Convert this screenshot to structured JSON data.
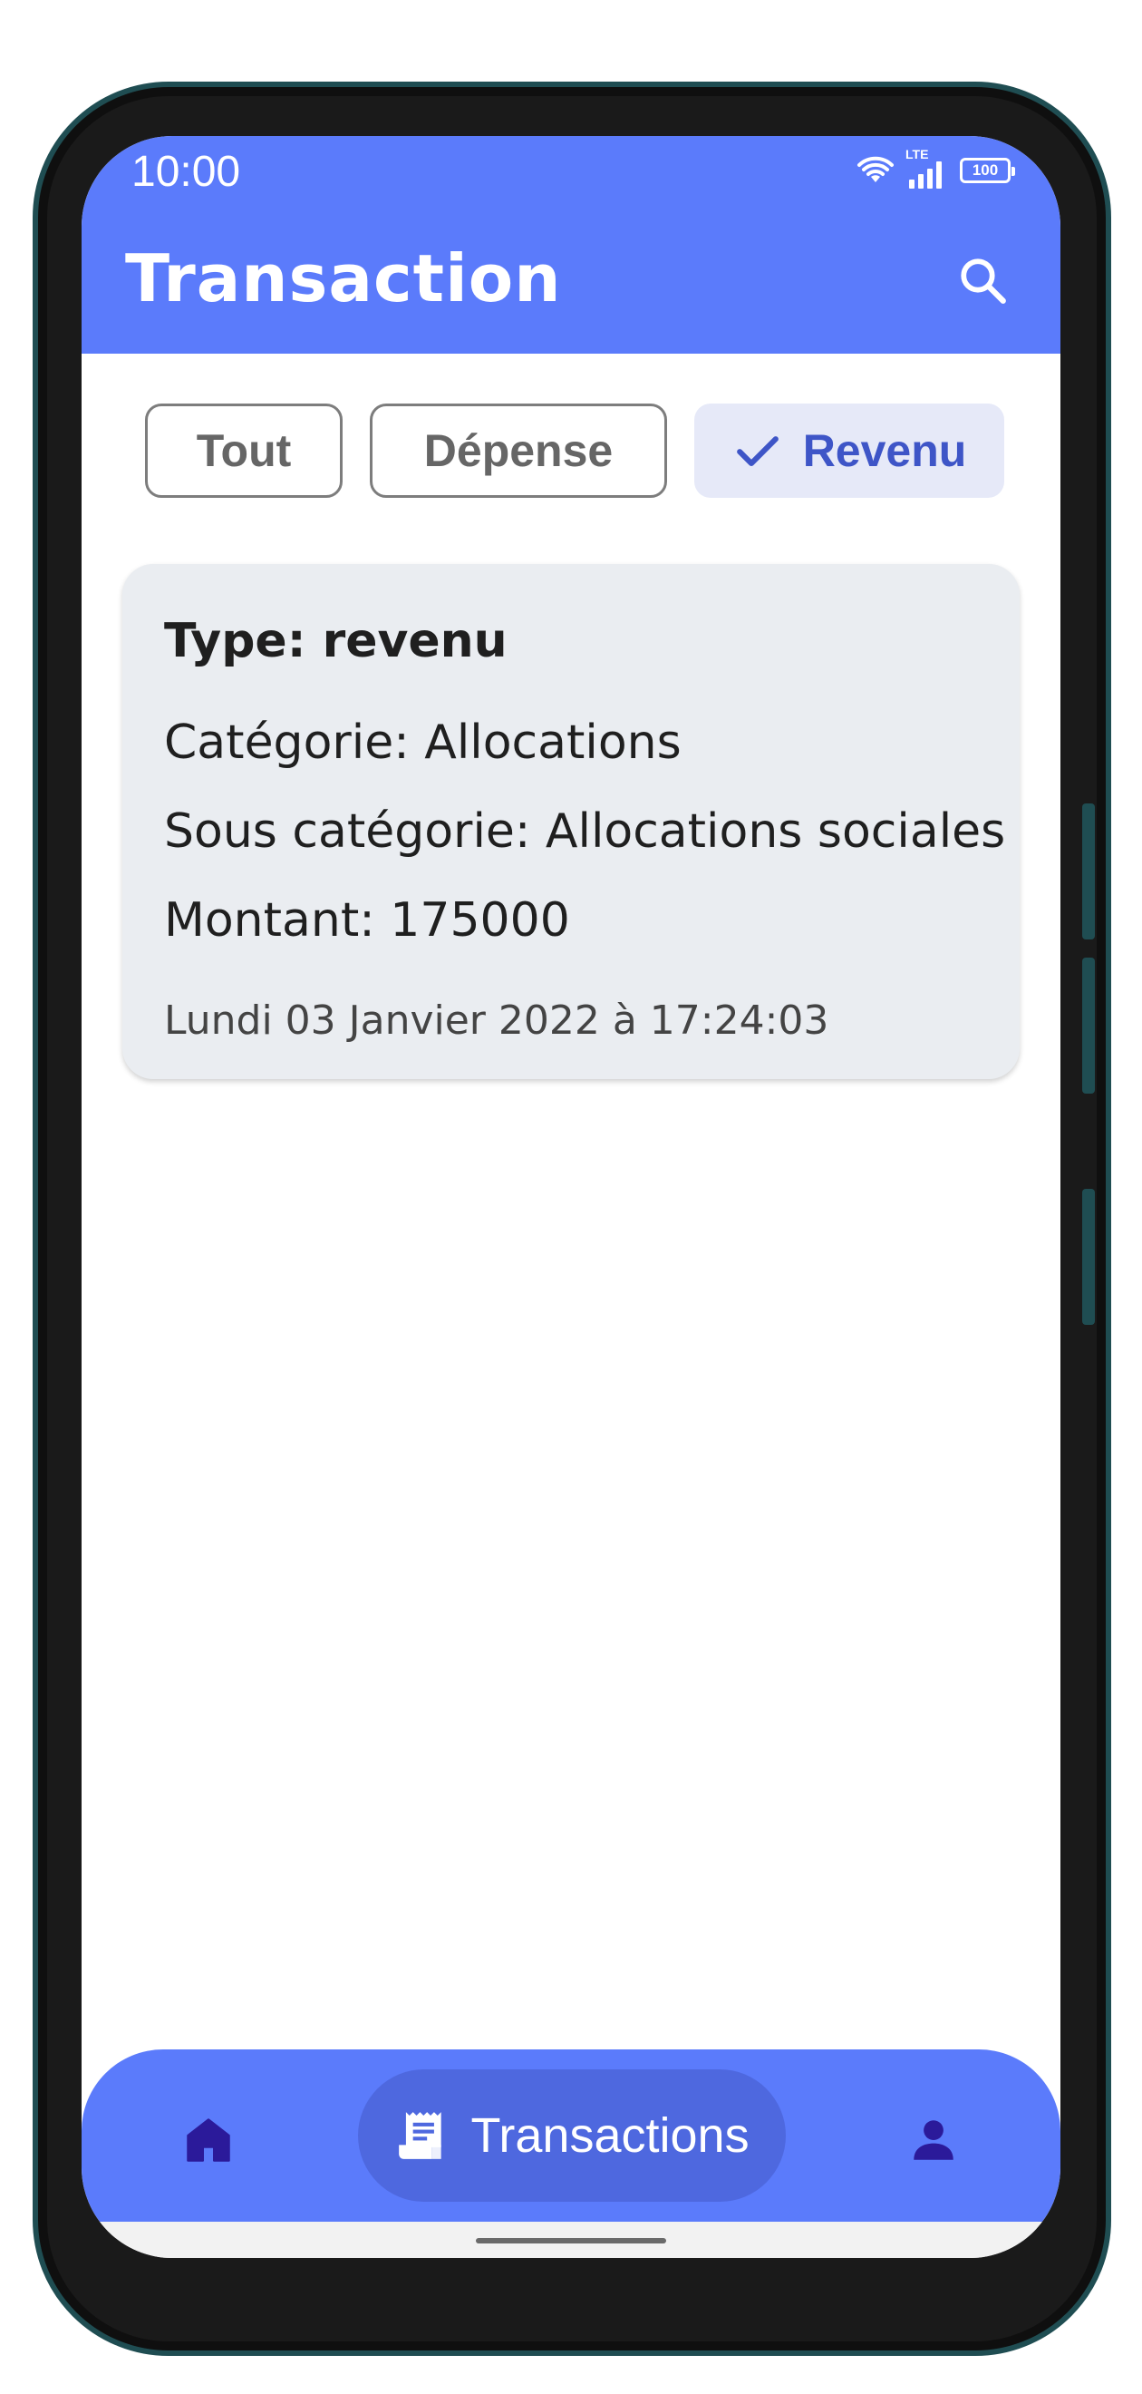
{
  "status_bar": {
    "time": "10:00",
    "network_label": "LTE",
    "battery_level": "100"
  },
  "app_bar": {
    "title": "Transaction",
    "search_icon": "search-icon"
  },
  "filters": {
    "selected": "Revenu",
    "chips": [
      {
        "label": "Tout"
      },
      {
        "label": "Dépense"
      },
      {
        "label": "Revenu"
      }
    ]
  },
  "transaction_card": {
    "type_line": "Type: revenu",
    "category_line": "Catégorie: Allocations",
    "subcategory_line": "Sous catégorie: Allocations sociales",
    "amount_line": "Montant: 175000",
    "date_line": "Lundi 03 Janvier 2022 à 17:24:03"
  },
  "bottom_nav": {
    "items": [
      {
        "icon": "home-icon",
        "label": ""
      },
      {
        "icon": "receipt-icon",
        "label": "Transactions"
      },
      {
        "icon": "person-icon",
        "label": ""
      }
    ]
  },
  "colors": {
    "primary": "#5b7bfb",
    "selected_chip_bg": "#e6e9f8",
    "selected_chip_text": "#3e55c7",
    "card_bg": "#eaedf1",
    "nav_icon": "#2b1a9a"
  }
}
